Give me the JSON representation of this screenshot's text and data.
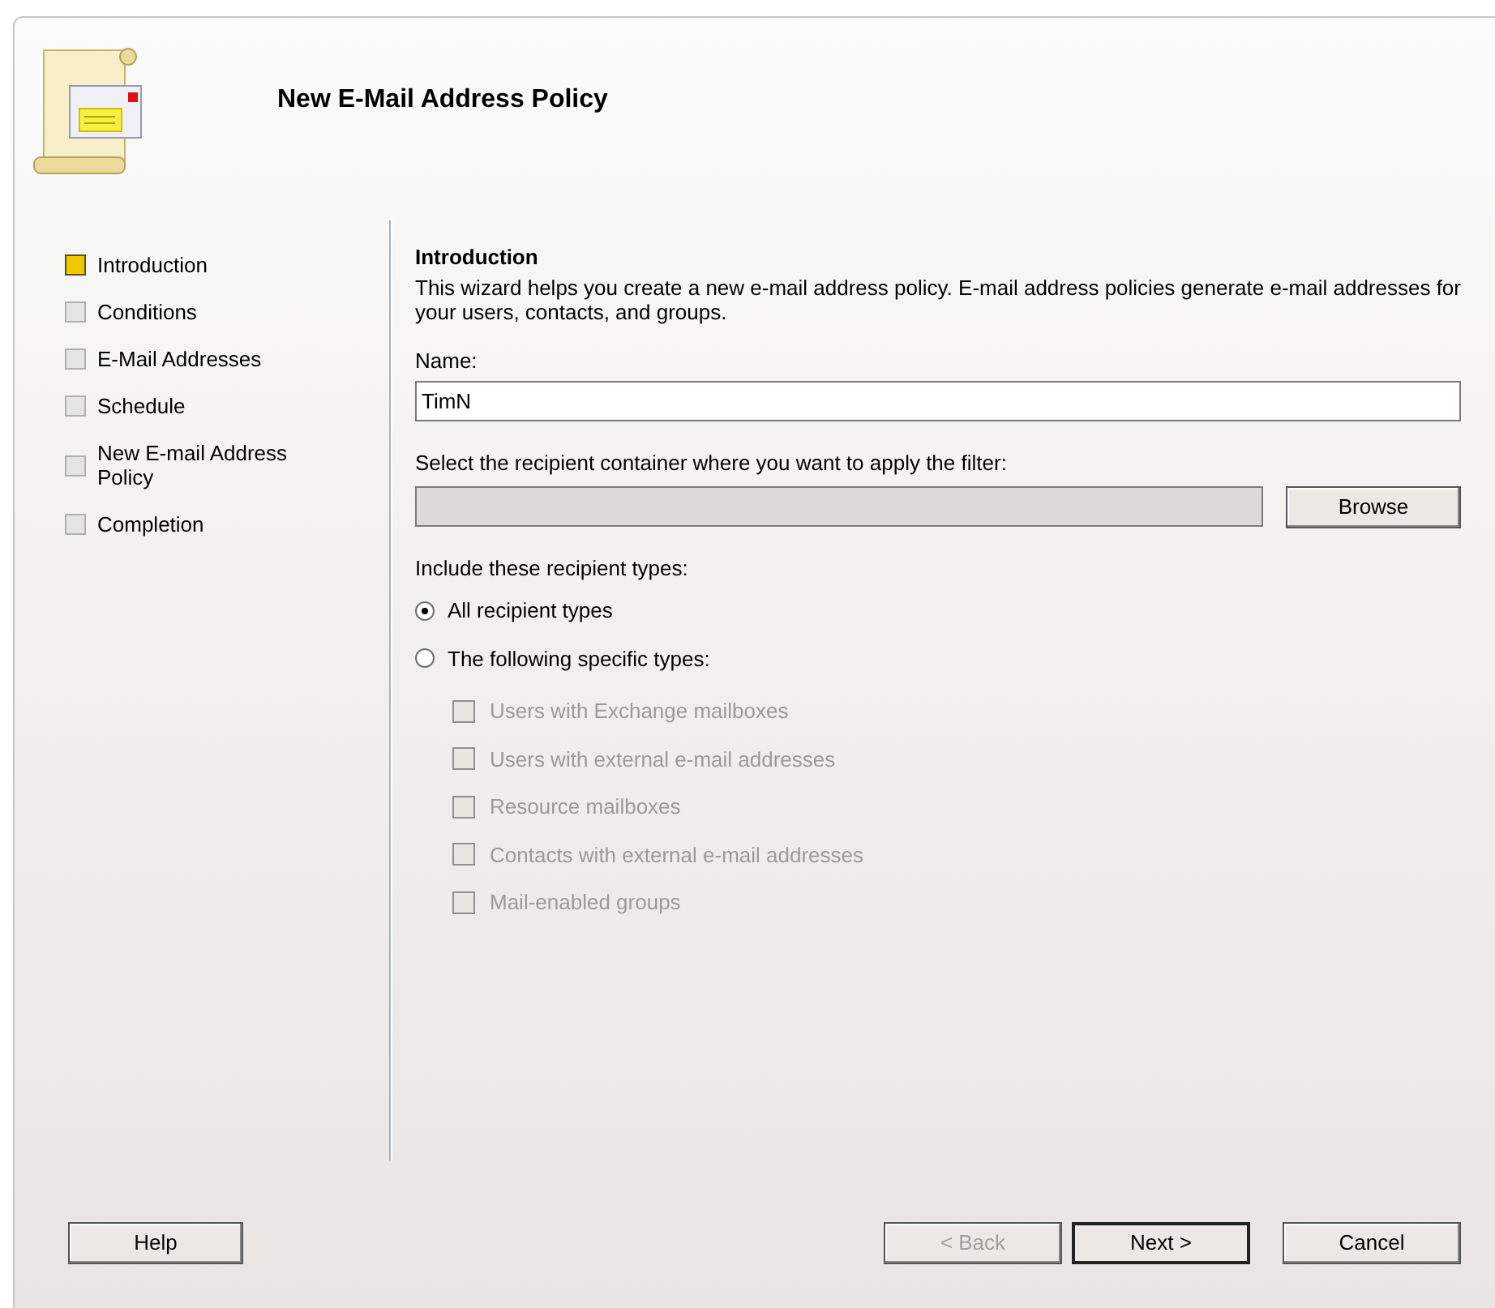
{
  "header": {
    "title": "New E-Mail Address Policy"
  },
  "steps": [
    {
      "label": "Introduction",
      "selected": true
    },
    {
      "label": "Conditions",
      "selected": false
    },
    {
      "label": "E-Mail Addresses",
      "selected": false
    },
    {
      "label": "Schedule",
      "selected": false
    },
    {
      "label": "New E-mail Address Policy",
      "selected": false
    },
    {
      "label": "Completion",
      "selected": false
    }
  ],
  "page": {
    "heading": "Introduction",
    "description": "This wizard helps you create a new e-mail address policy. E-mail address policies generate e-mail addresses for your users, contacts, and groups.",
    "name_label": "Name:",
    "name_value": "TimN",
    "container_label": "Select the recipient container where you want to apply the filter:",
    "container_value_disabled": true,
    "browse_button": "Browse",
    "types_label": "Include these recipient types:",
    "radios": [
      {
        "label": "All recipient types",
        "selected": true
      },
      {
        "label": "The following specific types:",
        "selected": false
      }
    ],
    "checkboxes": [
      {
        "label": "Users with Exchange mailboxes",
        "checked": false,
        "disabled": true
      },
      {
        "label": "Users with external e-mail addresses",
        "checked": false,
        "disabled": true
      },
      {
        "label": "Resource mailboxes",
        "checked": false,
        "disabled": true
      },
      {
        "label": "Contacts with external e-mail addresses",
        "checked": false,
        "disabled": true
      },
      {
        "label": "Mail-enabled groups",
        "checked": false,
        "disabled": true
      }
    ]
  },
  "buttons": [
    {
      "label": "Help",
      "kind": "left",
      "disabled": false,
      "default": false
    },
    {
      "label": "< Back",
      "kind": "right",
      "disabled": true,
      "default": false
    },
    {
      "label": "Next >",
      "kind": "right",
      "disabled": false,
      "default": true
    },
    {
      "label": "Cancel",
      "kind": "right",
      "disabled": false,
      "default": false
    }
  ]
}
